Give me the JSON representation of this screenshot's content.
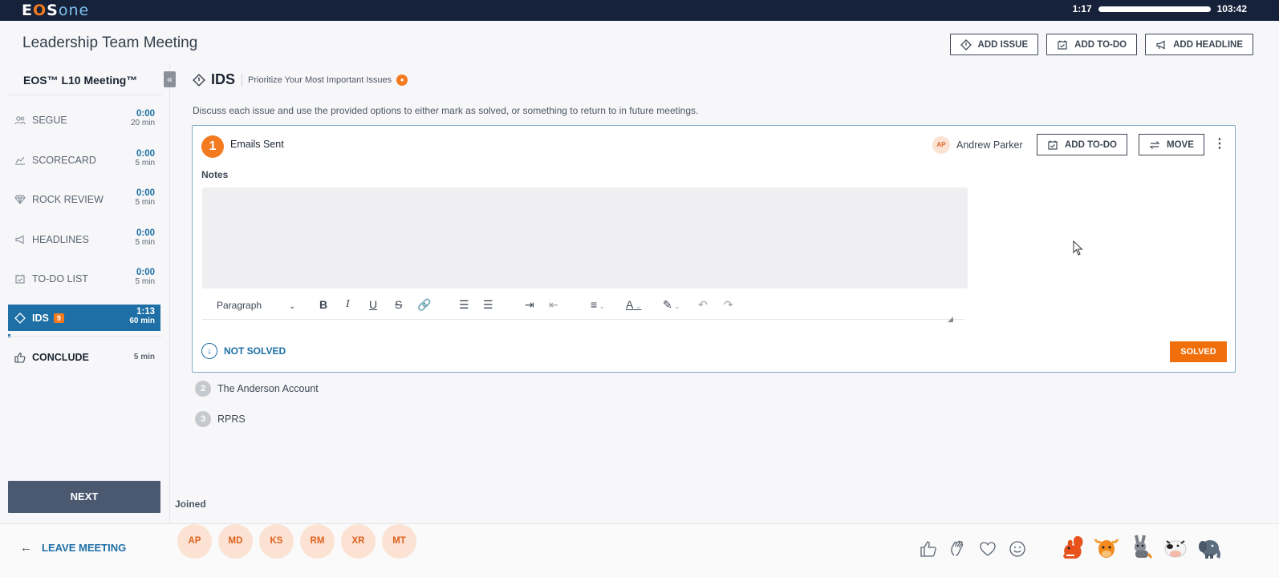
{
  "topbar": {
    "logo": {
      "e": "E",
      "o": "O",
      "s": "S",
      "one": "one"
    },
    "elapsed": "1:17",
    "total": "103:42"
  },
  "header": {
    "title": "Leadership Team Meeting",
    "add_issue": "ADD ISSUE",
    "add_todo": "ADD TO-DO",
    "add_headline": "ADD HEADLINE"
  },
  "sidebar": {
    "title": "EOS™ L10 Meeting™",
    "items": [
      {
        "label": "SEGUE",
        "time": "0:00",
        "duration": "20 min"
      },
      {
        "label": "SCORECARD",
        "time": "0:00",
        "duration": "5 min"
      },
      {
        "label": "ROCK REVIEW",
        "time": "0:00",
        "duration": "5 min"
      },
      {
        "label": "HEADLINES",
        "time": "0:00",
        "duration": "5 min"
      },
      {
        "label": "TO-DO LIST",
        "time": "0:00",
        "duration": "5 min"
      },
      {
        "label": "IDS",
        "badge": "9",
        "time": "1:13",
        "duration": "60 min"
      },
      {
        "label": "CONCLUDE",
        "duration": "5 min"
      }
    ],
    "next": "NEXT"
  },
  "ids": {
    "title": "IDS",
    "subtitle": "Prioritize Your Most Important Issues",
    "description": "Discuss each issue and use the provided options to either mark as solved, or something to return to in future meetings."
  },
  "active_issue": {
    "number": "1",
    "title": "Emails Sent",
    "owner_initials": "AP",
    "owner_name": "Andrew Parker",
    "add_todo": "ADD TO-DO",
    "move": "MOVE",
    "notes_label": "Notes",
    "paragraph": "Paragraph",
    "not_solved": "NOT SOLVED",
    "solved": "SOLVED"
  },
  "issues": [
    {
      "number": "2",
      "title": "The Anderson Account"
    },
    {
      "number": "3",
      "title": "RPRS"
    }
  ],
  "joined": {
    "label": "Joined",
    "attendees": [
      "AP",
      "MD",
      "KS",
      "RM",
      "XR",
      "MT"
    ]
  },
  "footer": {
    "leave": "LEAVE MEETING"
  },
  "colors": {
    "accent": "#1d6fa5",
    "orange": "#f47a1f",
    "navy": "#16213a"
  }
}
